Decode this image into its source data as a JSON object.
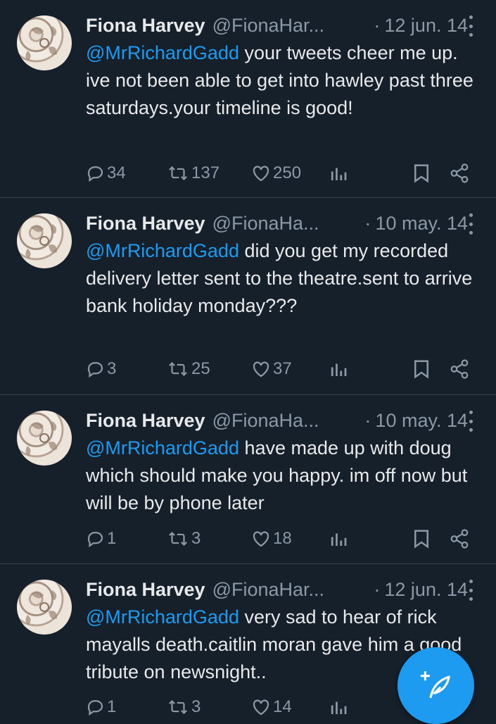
{
  "tweets": [
    {
      "name": "Fiona Harvey",
      "handle": "@FionaHar...",
      "dot": "·",
      "date": "12 jun. 14",
      "mention": "@MrRichardGadd",
      "text": " your tweets cheer me up. ive not been able to get into hawley past three saturdays.your timeline is good!",
      "replies": "34",
      "retweets": "137",
      "likes": "250"
    },
    {
      "name": "Fiona Harvey",
      "handle": "@FionaHa...",
      "dot": "·",
      "date": "10 may. 14",
      "mention": "@MrRichardGadd",
      "text": " did you get my recorded delivery letter sent to the theatre.sent to arrive bank holiday monday???",
      "replies": "3",
      "retweets": "25",
      "likes": "37"
    },
    {
      "name": "Fiona Harvey",
      "handle": "@FionaHa...",
      "dot": "·",
      "date": "10 may. 14",
      "mention": "@MrRichardGadd",
      "text": " have made up with doug which should make you happy. im off now but will be by phone later",
      "replies": "1",
      "retweets": "3",
      "likes": "18"
    },
    {
      "name": "Fiona Harvey",
      "handle": "@FionaHar...",
      "dot": "·",
      "date": "12 jun. 14",
      "mention": "@MrRichardGadd",
      "text": " very sad to hear of rick mayalls death.caitlin moran gave him a good tribute on newsnight..",
      "replies": "1",
      "retweets": "3",
      "likes": "14"
    }
  ],
  "icons": {
    "reply": "reply-icon",
    "retweet": "retweet-icon",
    "like": "like-icon",
    "views": "views-icon",
    "bookmark": "bookmark-icon",
    "share": "share-icon",
    "more": "more-icon",
    "compose": "compose-icon"
  },
  "colors": {
    "background": "#15202b",
    "accent": "#1d9bf0",
    "text": "#e7e9ea",
    "muted": "#8b98a5"
  }
}
